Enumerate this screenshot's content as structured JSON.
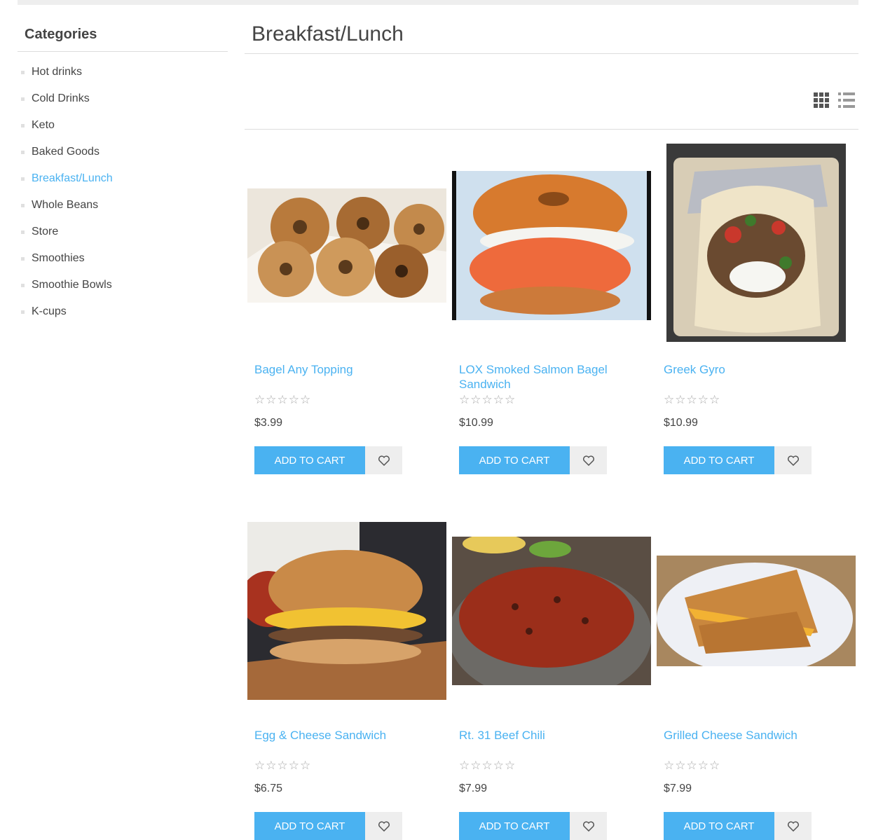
{
  "sidebar": {
    "title": "Categories",
    "items": [
      {
        "label": "Hot drinks"
      },
      {
        "label": "Cold Drinks"
      },
      {
        "label": "Keto"
      },
      {
        "label": "Baked Goods"
      },
      {
        "label": "Breakfast/Lunch",
        "active": true
      },
      {
        "label": "Whole Beans"
      },
      {
        "label": "Store"
      },
      {
        "label": "Smoothies"
      },
      {
        "label": "Smoothie Bowls"
      },
      {
        "label": "K-cups"
      }
    ]
  },
  "main": {
    "title": "Breakfast/Lunch",
    "view_icons": [
      "grid-view-icon",
      "list-view-icon"
    ]
  },
  "products": [
    {
      "name": "Bagel Any Topping",
      "price": "$3.99",
      "rating": "☆☆☆☆☆",
      "button": "Add to cart",
      "image": "bagels-photo"
    },
    {
      "name": "LOX Smoked Salmon Bagel Sandwich",
      "price": "$10.99",
      "rating": "☆☆☆☆☆",
      "button": "Add to cart",
      "image": "salmon-bagel-photo"
    },
    {
      "name": "Greek Gyro",
      "price": "$10.99",
      "rating": "☆☆☆☆☆",
      "button": "Add to cart",
      "image": "gyro-photo"
    },
    {
      "name": "Egg & Cheese Sandwich",
      "price": "$6.75",
      "rating": "☆☆☆☆☆",
      "button": "Add to cart",
      "image": "egg-sandwich-photo"
    },
    {
      "name": "Rt. 31 Beef Chili",
      "price": "$7.99",
      "rating": "☆☆☆☆☆",
      "button": "Add to cart",
      "image": "chili-photo"
    },
    {
      "name": "Grilled Cheese Sandwich",
      "price": "$7.99",
      "rating": "☆☆☆☆☆",
      "button": "Add to cart",
      "image": "grilled-cheese-photo"
    }
  ],
  "colors": {
    "accent": "#4ab2f1",
    "text": "#444444",
    "border": "#dddddd",
    "button_alt": "#eeeeee"
  }
}
